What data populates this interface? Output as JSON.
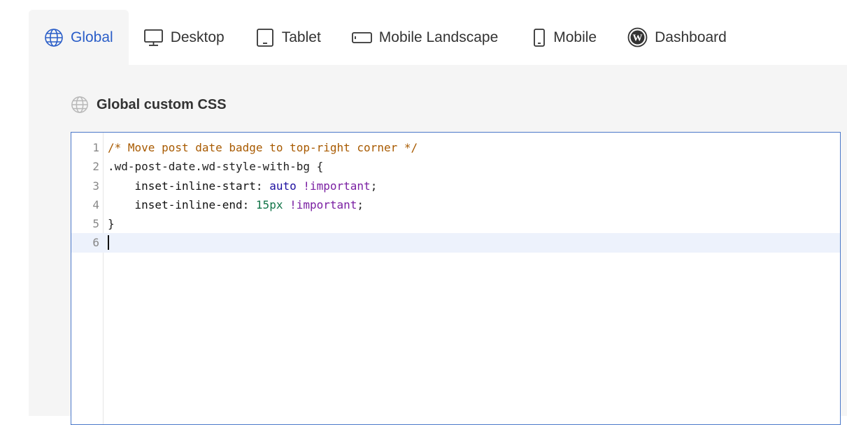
{
  "tabs": [
    {
      "label": "Global",
      "icon": "globe-icon",
      "active": true
    },
    {
      "label": "Desktop",
      "icon": "desktop-icon",
      "active": false
    },
    {
      "label": "Tablet",
      "icon": "tablet-icon",
      "active": false
    },
    {
      "label": "Mobile Landscape",
      "icon": "mobile-landscape-icon",
      "active": false
    },
    {
      "label": "Mobile",
      "icon": "mobile-icon",
      "active": false
    },
    {
      "label": "Dashboard",
      "icon": "wordpress-icon",
      "active": false
    }
  ],
  "section": {
    "title": "Global custom CSS",
    "icon": "globe-icon"
  },
  "editor": {
    "line_numbers": [
      "1",
      "2",
      "3",
      "4",
      "5",
      "6"
    ],
    "active_line": 6,
    "lines": {
      "l1_comment": "/* Move post date badge to top-right corner */",
      "l2_selector": ".wd-post-date.wd-style-with-bg {",
      "l3_prop": "    inset-inline-start: ",
      "l3_value": "auto",
      "l3_important": " !important",
      "l3_end": ";",
      "l4_prop": "    inset-inline-end: ",
      "l4_value": "15px",
      "l4_important": " !important",
      "l4_end": ";",
      "l5_close": "}",
      "l6_text": ""
    }
  },
  "colors": {
    "accent": "#2b5ec8",
    "panel_bg": "#f5f5f5",
    "editor_border": "#4a78c9",
    "active_line_bg": "#edf2fc",
    "comment": "#a85a00",
    "keyword": "#1d0fa0",
    "important": "#7a1fa2",
    "number": "#127548"
  }
}
